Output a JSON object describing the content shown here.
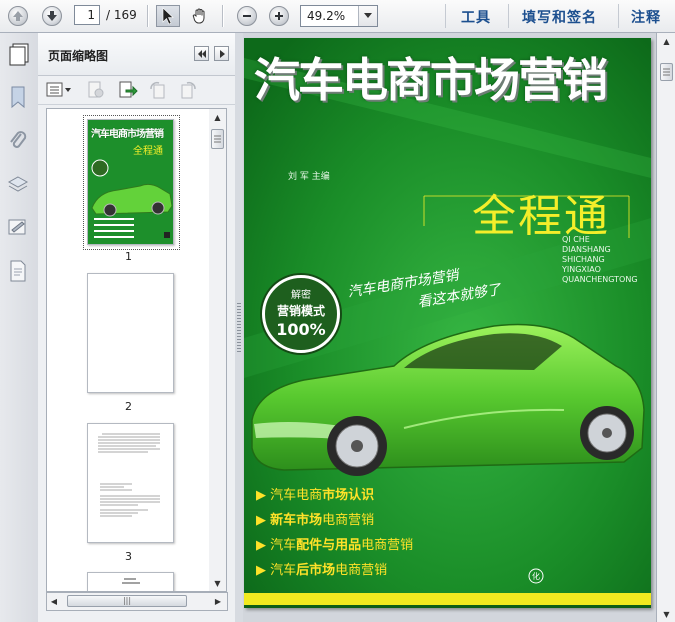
{
  "toolbar": {
    "current_page": "1",
    "total_pages": "/ 169",
    "zoom": "49.2%",
    "tools_label": "工具",
    "sign_label": "填写和签名",
    "comment_label": "注释"
  },
  "panel": {
    "title": "页面缩略图",
    "thumbnails": [
      {
        "label": "1"
      },
      {
        "label": "2"
      },
      {
        "label": "3"
      }
    ],
    "cover_mini_title": "汽车电商市场营销",
    "cover_mini_subtitle": "全程通"
  },
  "cover": {
    "title": "汽车电商市场营销",
    "author": "刘 军   主编",
    "subtitle": "全程通",
    "pinyin": [
      "QI CHE",
      "DIANSHANG",
      "SHICHANG",
      "YINGXIAO",
      "QUANCHENGTONG"
    ],
    "badge_top": "解密",
    "badge_mid": "营销模式",
    "badge_pct": "100%",
    "slogan_line1": "汽车电商市场营销",
    "slogan_line2": "看这本就够了",
    "bullets": [
      {
        "pre": "汽车电商",
        "bold": "市场认识",
        "post": ""
      },
      {
        "pre": "",
        "bold": "新车市场",
        "post": "电商营销"
      },
      {
        "pre": "汽车",
        "bold": "配件与用品",
        "post": "电商营销"
      },
      {
        "pre": "汽车",
        "bold": "后市场",
        "post": "电商营销"
      }
    ]
  },
  "colors": {
    "cover_green": "#1c8f2a",
    "title_white": "#ffffff",
    "subtitle_yellow": "#f4ee2a",
    "bullet_yellow": "#ffe229",
    "link_blue": "#1c4f8f"
  }
}
